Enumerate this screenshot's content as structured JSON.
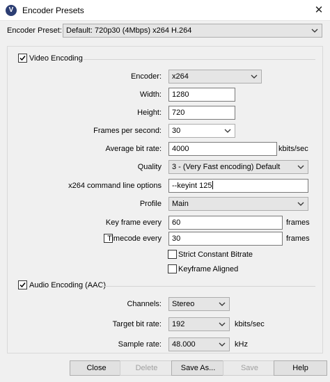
{
  "window": {
    "title": "Encoder Presets",
    "icon": "app-logo-icon",
    "app_initial": "V"
  },
  "preset": {
    "label": "Encoder Preset:",
    "value": "Default: 720p30 (4Mbps) x264 H.264"
  },
  "video": {
    "section_label": "Video Encoding",
    "enabled": true,
    "encoder": {
      "label": "Encoder:",
      "value": "x264"
    },
    "width": {
      "label": "Width:",
      "value": "1280"
    },
    "height": {
      "label": "Height:",
      "value": "720"
    },
    "fps": {
      "label": "Frames per second:",
      "value": "30"
    },
    "bitrate": {
      "label": "Average bit rate:",
      "value": "4000",
      "unit": "kbits/sec"
    },
    "quality": {
      "label": "Quality",
      "value": "3 - (Very Fast encoding) Default"
    },
    "cmdline": {
      "label": "x264 command line options",
      "value": "--keyint 125"
    },
    "profile": {
      "label": "Profile",
      "value": "Main"
    },
    "keyframe": {
      "label": "Key frame every",
      "value": "60",
      "unit": "frames"
    },
    "timecode": {
      "label": "Timecode every",
      "value": "30",
      "unit": "frames",
      "enabled": false
    },
    "strict_cbr": {
      "label": "Strict Constant Bitrate",
      "checked": false
    },
    "keyframe_aligned": {
      "label": "Keyframe Aligned",
      "checked": false
    }
  },
  "audio": {
    "section_label": "Audio Encoding (AAC)",
    "enabled": true,
    "channels": {
      "label": "Channels:",
      "value": "Stereo"
    },
    "bitrate": {
      "label": "Target bit rate:",
      "value": "192",
      "unit": "kbits/sec"
    },
    "samplerate": {
      "label": "Sample rate:",
      "value": "48.000",
      "unit": "kHz"
    }
  },
  "buttons": {
    "close": "Close",
    "delete": "Delete",
    "save_as": "Save As...",
    "save": "Save",
    "help": "Help"
  }
}
